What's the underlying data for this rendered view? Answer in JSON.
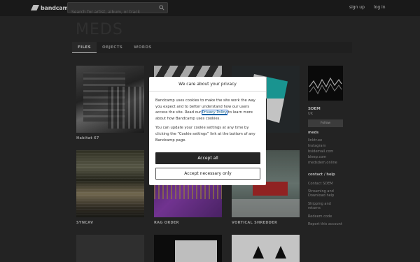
{
  "header": {
    "logo_text": "bandcamp",
    "search_placeholder": "Search for artist, album, or track",
    "signup_label": "sign up",
    "login_label": "log in"
  },
  "artist": {
    "title": "MEDS",
    "tabs": [
      "FILES",
      "OBJECTS",
      "WORDS"
    ]
  },
  "releases": [
    {
      "title": "Habitat 67"
    },
    {
      "title": ""
    },
    {
      "title": ""
    },
    {
      "title": "SYNCAV"
    },
    {
      "title": "RAG ORDER"
    },
    {
      "title": "VORTICAL SHREDDER"
    }
  ],
  "sidebar": {
    "name": "SDEM",
    "location": "UK",
    "follow_label": "Follow",
    "section_meds": "meds",
    "links": [
      "linktr.ee",
      "Instagram",
      "bsidemail.com",
      "bleep.com",
      "medsdem.online"
    ],
    "contact_heading": "contact / help",
    "contact_links": [
      "Contact SDEM",
      "Streaming and Download help",
      "Shipping and returns",
      "Redeem code",
      "Report this account"
    ]
  },
  "cookie_modal": {
    "title": "We care about your privacy",
    "para1_before": "Bandcamp uses cookies to make the site work the way you expect and to better understand how our users access the site. Read our ",
    "privacy_link": "Privacy Policy",
    "para1_after": " to learn more about how Bandcamp uses cookies.",
    "para2": "You can update your cookie settings at any time by clicking the “Cookie settings” link at the bottom of any Bandcamp page.",
    "accept_all_label": "Accept all",
    "accept_necessary_label": "Accept necessary only"
  }
}
